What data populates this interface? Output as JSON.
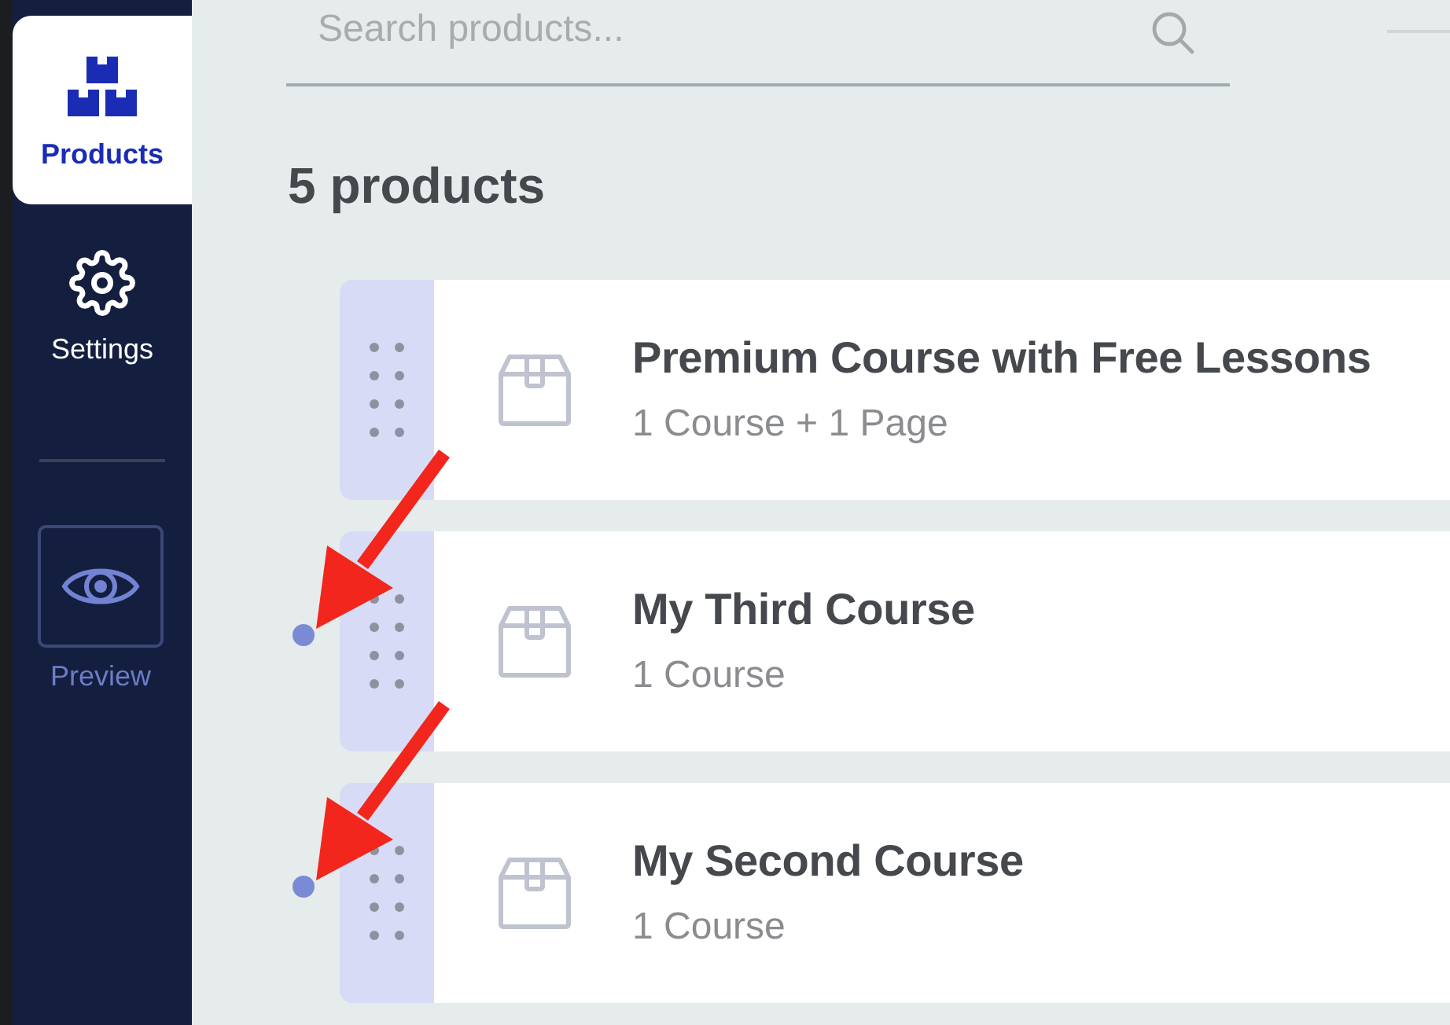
{
  "sidebar": {
    "items": [
      {
        "label": "Products",
        "selected": true
      },
      {
        "label": "Settings",
        "selected": false
      }
    ],
    "preview_button": {
      "label": "Preview"
    }
  },
  "search": {
    "placeholder": "Search products..."
  },
  "heading": "5 products",
  "products": [
    {
      "title": "Premium Course with Free Lessons",
      "subtitle": "1 Course + 1 Page",
      "marker": false,
      "arrow": false
    },
    {
      "title": "My Third Course",
      "subtitle": "1 Course",
      "marker": true,
      "arrow": true
    },
    {
      "title": "My Second Course",
      "subtitle": "1 Course",
      "marker": true,
      "arrow": true
    }
  ]
}
